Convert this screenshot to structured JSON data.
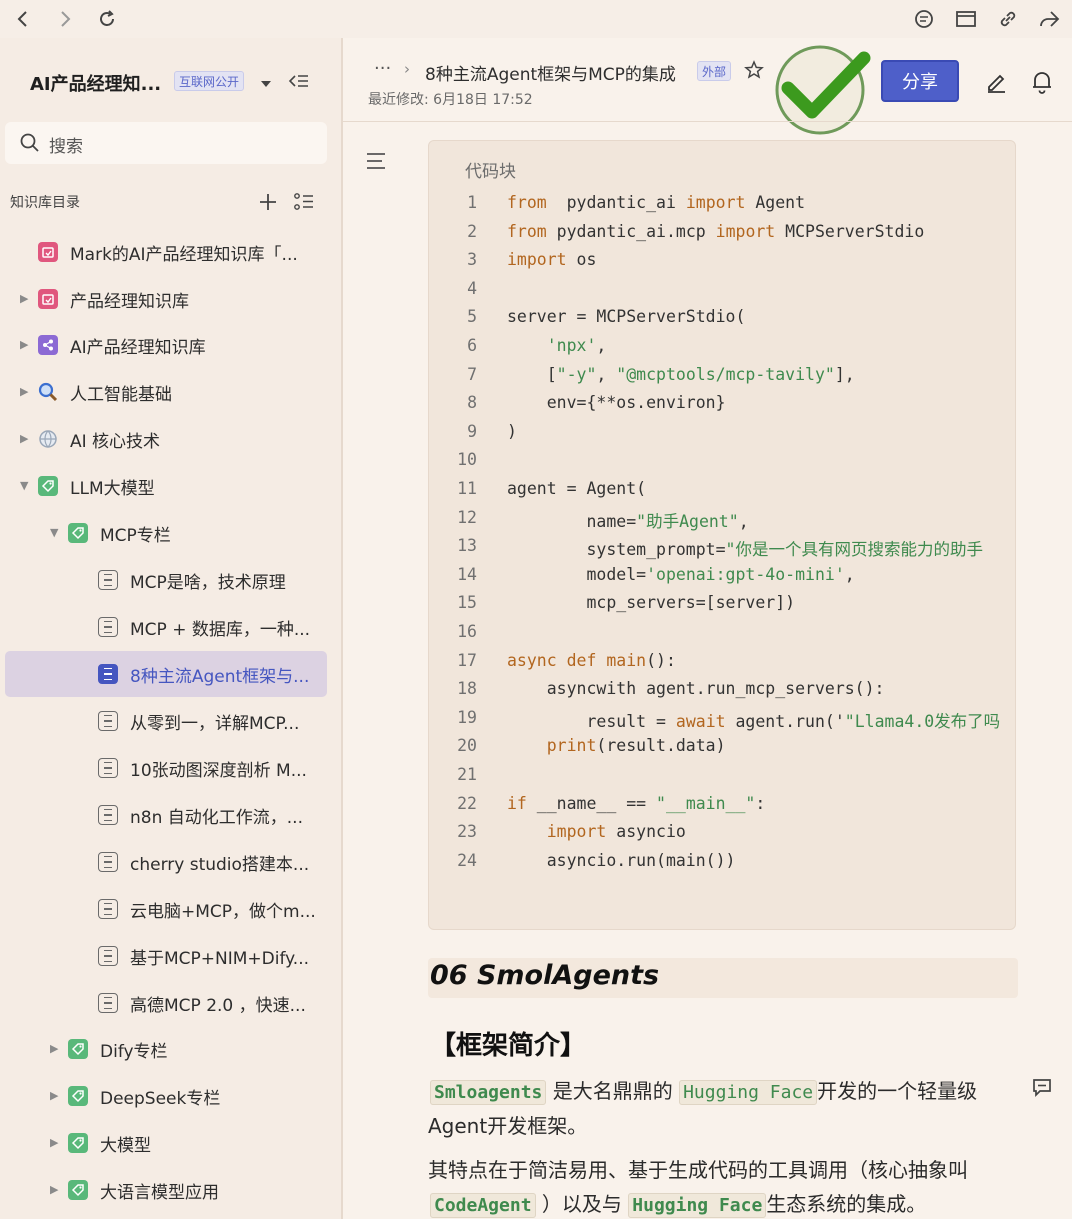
{
  "header": {
    "breadcrumb_more": "···",
    "breadcrumb_arrow": "›",
    "doc_title": "8种主流Agent框架与MCP的集成",
    "doc_tag": "外部",
    "modified": "最近修改: 6月18日 17:52",
    "share_label": "分享"
  },
  "sidebar": {
    "kb_title": "AI产品经理知...",
    "kb_tag": "互联网公开",
    "search_placeholder": "搜索",
    "toc_title": "知识库目录",
    "items": [
      {
        "label": "Mark的AI产品经理知识库「...",
        "icon": "pink-calendar-icon",
        "color": "#e0577e"
      },
      {
        "label": "产品经理知识库",
        "icon": "pink-calendar-icon",
        "color": "#e0577e"
      },
      {
        "label": "AI产品经理知识库",
        "icon": "purple-share-icon",
        "color": "#8c6ad4"
      },
      {
        "label": "人工智能基础",
        "icon": "magnifier-icon",
        "color": "#3b6fd0"
      },
      {
        "label": "AI 核心技术",
        "icon": "globe-icon",
        "color": "#9aa7b8"
      },
      {
        "label": "LLM大模型",
        "icon": "green-tag-icon",
        "color": "#59b87a"
      },
      {
        "label": "MCP专栏",
        "icon": "green-tag-icon",
        "color": "#59b87a"
      },
      {
        "label": "MCP是啥，技术原理",
        "icon": "doc-icon"
      },
      {
        "label": "MCP + 数据库，一种...",
        "icon": "doc-icon"
      },
      {
        "label": "8种主流Agent框架与...",
        "icon": "doc-icon",
        "color": "#4556c0"
      },
      {
        "label": "从零到一，详解MCP...",
        "icon": "doc-icon"
      },
      {
        "label": "10张动图深度剖析 M...",
        "icon": "doc-icon"
      },
      {
        "label": "n8n 自动化工作流，...",
        "icon": "doc-icon"
      },
      {
        "label": "cherry studio搭建本...",
        "icon": "doc-icon"
      },
      {
        "label": "云电脑+MCP，做个m...",
        "icon": "doc-icon"
      },
      {
        "label": "基于MCP+NIM+Dify...",
        "icon": "doc-icon"
      },
      {
        "label": "高德MCP 2.0 ，快速...",
        "icon": "doc-icon"
      },
      {
        "label": "Dify专栏",
        "icon": "green-tag-icon",
        "color": "#59b87a"
      },
      {
        "label": "DeepSeek专栏",
        "icon": "green-tag-icon",
        "color": "#59b87a"
      },
      {
        "label": "大模型",
        "icon": "green-tag-icon",
        "color": "#59b87a"
      },
      {
        "label": "大语言模型应用",
        "icon": "green-tag-icon",
        "color": "#59b87a"
      }
    ]
  },
  "code": {
    "caption": "代码块",
    "lines": [
      {
        "n": "1",
        "parts": [
          [
            "kw",
            "from"
          ],
          [
            "",
            "  pydantic_ai "
          ],
          [
            "kw",
            "import"
          ],
          [
            "",
            " Agent"
          ]
        ]
      },
      {
        "n": "2",
        "parts": [
          [
            "kw",
            "from"
          ],
          [
            "",
            " pydantic_ai.mcp "
          ],
          [
            "kw",
            "import"
          ],
          [
            "",
            " MCPServerStdio"
          ]
        ]
      },
      {
        "n": "3",
        "parts": [
          [
            "kw",
            "import"
          ],
          [
            "",
            " os"
          ]
        ]
      },
      {
        "n": "4",
        "parts": []
      },
      {
        "n": "5",
        "parts": [
          [
            "",
            "server = MCPServerStdio("
          ]
        ]
      },
      {
        "n": "6",
        "parts": [
          [
            "",
            "    "
          ],
          [
            "str",
            "'npx'"
          ],
          [
            "",
            ","
          ]
        ]
      },
      {
        "n": "7",
        "parts": [
          [
            "",
            "    ["
          ],
          [
            "str",
            "\"-y\""
          ],
          [
            "",
            ", "
          ],
          [
            "str",
            "\"@mcptools/mcp-tavily\""
          ],
          [
            "",
            "],"
          ]
        ]
      },
      {
        "n": "8",
        "parts": [
          [
            "",
            "    env={**os.environ}"
          ]
        ]
      },
      {
        "n": "9",
        "parts": [
          [
            "",
            ")"
          ]
        ]
      },
      {
        "n": "10",
        "parts": []
      },
      {
        "n": "11",
        "parts": [
          [
            "",
            "agent = Agent("
          ]
        ]
      },
      {
        "n": "12",
        "parts": [
          [
            "",
            "        name="
          ],
          [
            "str",
            "\"助手Agent\""
          ],
          [
            "",
            ","
          ]
        ]
      },
      {
        "n": "13",
        "parts": [
          [
            "",
            "        system_prompt="
          ],
          [
            "str",
            "\"你是一个具有网页搜索能力的助手"
          ]
        ]
      },
      {
        "n": "14",
        "parts": [
          [
            "",
            "        model="
          ],
          [
            "str",
            "'openai:gpt-4o-mini'"
          ],
          [
            "",
            ","
          ]
        ]
      },
      {
        "n": "15",
        "parts": [
          [
            "",
            "        mcp_servers=[server])"
          ]
        ]
      },
      {
        "n": "16",
        "parts": []
      },
      {
        "n": "17",
        "parts": [
          [
            "kw",
            "async def main"
          ],
          [
            "",
            "():"
          ]
        ]
      },
      {
        "n": "18",
        "parts": [
          [
            "",
            "    asyncwith agent.run_mcp_servers():"
          ]
        ]
      },
      {
        "n": "19",
        "parts": [
          [
            "",
            "        result = "
          ],
          [
            "kw",
            "await"
          ],
          [
            "",
            " agent.run('"
          ],
          [
            "str",
            "\"Llama4.0发布了吗"
          ]
        ]
      },
      {
        "n": "20",
        "parts": [
          [
            "kw",
            "    print"
          ],
          [
            "",
            "(result.data)"
          ]
        ]
      },
      {
        "n": "21",
        "parts": []
      },
      {
        "n": "22",
        "parts": [
          [
            "kw",
            "if"
          ],
          [
            "",
            " __name__ == "
          ],
          [
            "str",
            "\"__main__\""
          ],
          [
            "",
            ":"
          ]
        ]
      },
      {
        "n": "23",
        "parts": [
          [
            "kw",
            "    import"
          ],
          [
            "",
            " asyncio"
          ]
        ]
      },
      {
        "n": "24",
        "parts": [
          [
            "",
            "    asyncio.run(main())"
          ]
        ]
      }
    ]
  },
  "article": {
    "h2": "06 SmolAgents",
    "h3": "【框架简介】",
    "p1_code1": "Smloagents",
    "p1_text1": "是大名鼎鼎的",
    "p1_code2": "Hugging Face",
    "p1_text2": "开发的一个轻量级",
    "p1_line2": "Agent开发框架。",
    "p2_line1": "其特点在于简洁易用、基于生成代码的工具调用（核心抽象叫",
    "p2_code1": "CodeAgent",
    "p2_text1": "）以及与",
    "p2_code2": "Hugging Face",
    "p2_text2": "生态系统的集成。"
  },
  "colors": {
    "accent": "#4e5fc9",
    "check_green": "#3c9a1e",
    "keyword": "#b2661f",
    "string": "#3f8a4e"
  }
}
